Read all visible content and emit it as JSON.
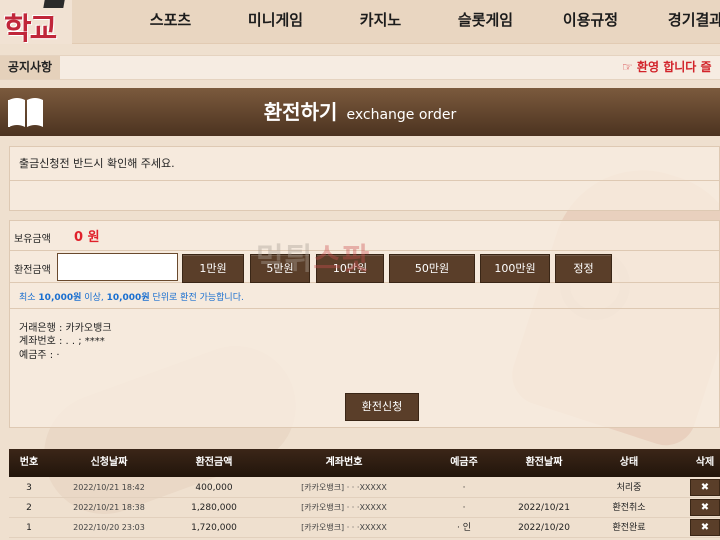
{
  "brand": {
    "logo_text": "학교"
  },
  "nav": [
    "스포츠",
    "미니게임",
    "카지노",
    "슬롯게임",
    "이용규정",
    "경기결과"
  ],
  "notice": {
    "label": "공지사항",
    "text": "☞ 환영 합니다 즐"
  },
  "page_title": {
    "main": "환전하기",
    "sub": "exchange order"
  },
  "info_message": "출금신청전 반드시 확인해 주세요.",
  "form": {
    "balance_label": "보유금액",
    "balance_value": "0 원",
    "amount_label": "환전금액",
    "amount_value": "",
    "amount_buttons": [
      "1만원",
      "5만원",
      "10만원",
      "50만원",
      "100만원",
      "정정"
    ],
    "hint_prefix": "최소 ",
    "hint_min": "10,000원",
    "hint_mid": " 이상, ",
    "hint_unit": "10,000원",
    "hint_suffix": " 단위로 환전 가능합니다.",
    "bank_line": "거래은행 : 카카오뱅크",
    "account_line": "계좌번호 :  .   .   ; ****",
    "holder_line": "예금주 :  ·"
  },
  "submit_label": "환전신청",
  "watermark": {
    "left": "먹튀",
    "right": "스팟"
  },
  "table": {
    "headers": [
      "번호",
      "신청날짜",
      "환전금액",
      "계좌번호",
      "예금주",
      "환전날짜",
      "상태",
      "삭제"
    ],
    "rows": [
      {
        "no": "3",
        "req_date": "2022/10/21 18:42",
        "amount": "400,000",
        "account": "[카카오뱅크]  · · ·XXXXX",
        "holder": "·",
        "done_date": "",
        "status": "처리중"
      },
      {
        "no": "2",
        "req_date": "2022/10/21 18:38",
        "amount": "1,280,000",
        "account": "[카카오뱅크]  · · ·XXXXX",
        "holder": "·",
        "done_date": "2022/10/21",
        "status": "환전취소"
      },
      {
        "no": "1",
        "req_date": "2022/10/20 23:03",
        "amount": "1,720,000",
        "account": "[카카오뱅크]  · · ·XXXXX",
        "holder": "· 인",
        "done_date": "2022/10/20",
        "status": "환전완료"
      }
    ],
    "delete_glyph": "✖"
  },
  "colors": {
    "accent_brown": "#5a3e29",
    "notice_red": "#d2232a",
    "balance_red": "#e0202a",
    "hint_blue": "#1a6fd0"
  },
  "icons": [
    "book-icon",
    "delete-icon"
  ]
}
